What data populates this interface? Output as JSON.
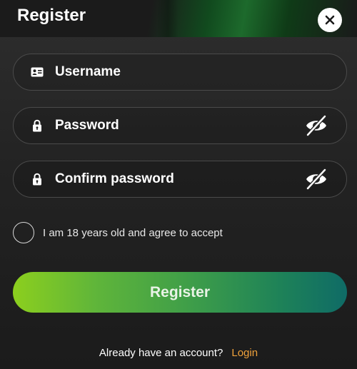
{
  "modal": {
    "title": "Register",
    "close_icon": "close-icon"
  },
  "fields": {
    "username": {
      "placeholder": "Username",
      "value": "",
      "icon": "id-card-icon"
    },
    "password": {
      "placeholder": "Password",
      "value": "",
      "icon": "lock-icon",
      "toggle_icon": "eye-off-icon"
    },
    "confirm_password": {
      "placeholder": "Confirm password",
      "value": "",
      "icon": "lock-icon",
      "toggle_icon": "eye-off-icon"
    }
  },
  "agreement": {
    "label": "I am 18 years old and agree to accept",
    "checked": false
  },
  "register_button": {
    "label": "Register"
  },
  "footer": {
    "prompt": "Already have an account?",
    "login_label": "Login"
  },
  "colors": {
    "accent_link": "#f0a23b",
    "button_gradient_start": "#8ccf1e",
    "button_gradient_end": "#0f6b66",
    "background": "#232323"
  }
}
